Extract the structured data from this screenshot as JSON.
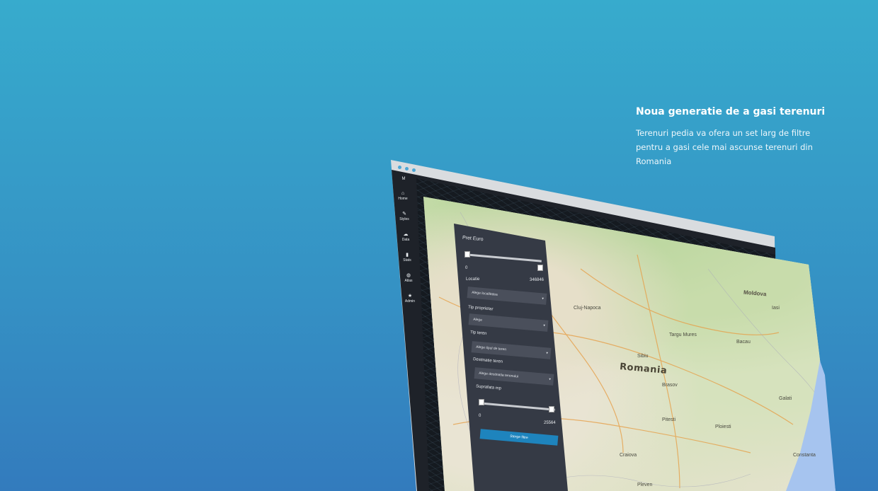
{
  "hero": {
    "title": "Noua generatie de a gasi terenuri",
    "description": "Terenuri pedia va ofera un set larg de filtre pentru a gasi cele mai ascunse terenuri din Romania"
  },
  "app": {
    "logo": "M",
    "sidebar": [
      {
        "label": "Home",
        "icon": "home-icon",
        "glyph": "⌂"
      },
      {
        "label": "Styles",
        "icon": "brush-icon",
        "glyph": "✎"
      },
      {
        "label": "Data",
        "icon": "cloud-icon",
        "glyph": "☁"
      },
      {
        "label": "Stats",
        "icon": "bar-chart-icon",
        "glyph": "▮"
      },
      {
        "label": "Atlas",
        "icon": "globe-icon",
        "glyph": "◍"
      },
      {
        "label": "Admin",
        "icon": "star-icon",
        "glyph": "★"
      }
    ]
  },
  "filters": {
    "price_label": "Pret Euro",
    "price_min": "0",
    "location_label": "Locatie",
    "location_value": "346846",
    "location_placeholder": "Alege localitatea",
    "owner_type_label": "Tip proprietar",
    "owner_type_placeholder": "Alege",
    "land_type_label": "Tip teren",
    "land_type_placeholder": "Alege tipul de teren",
    "land_use_label": "Destinatie teren",
    "land_use_placeholder": "Alege destinatia terenului",
    "area_label": "Suprafata mp",
    "area_min": "0",
    "area_max": "25564",
    "clear_button": "Sterge filtre"
  },
  "map": {
    "country": "Romania",
    "regions": [
      "Moldova"
    ],
    "cities": [
      "Cluj-Napoca",
      "Brasov",
      "Pitesti",
      "Craiova",
      "Iasi",
      "Bacau",
      "Galati",
      "Constanta",
      "Sibiu",
      "Targu Mures",
      "Ploiesti",
      "Pleven"
    ]
  },
  "colors": {
    "accent": "#1e84bd",
    "background_top": "#37abcd",
    "background_bottom": "#337bbd"
  }
}
